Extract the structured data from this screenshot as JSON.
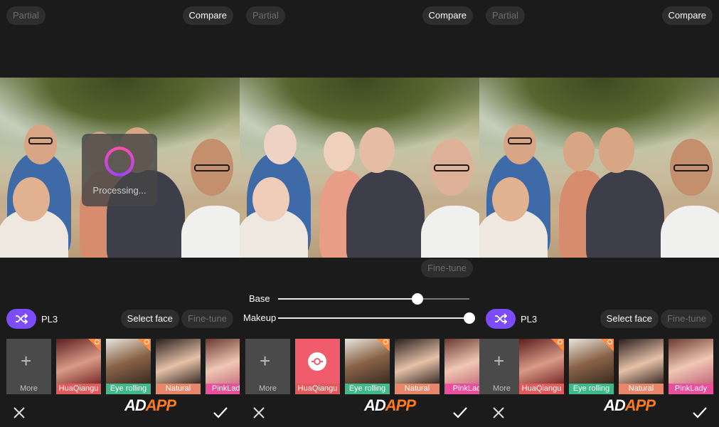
{
  "colors": {
    "accent": "#7c4dff",
    "selected": "#ff5aa5",
    "badge": "#ff8a3d"
  },
  "watermark": {
    "prefix": "AD",
    "suffix": "APP"
  },
  "panels": [
    {
      "top": {
        "partial": "Partial",
        "compare": "Compare"
      },
      "processing": "Processing...",
      "style": {
        "name": "PL3",
        "select_face": "Select face",
        "fine_tune": "Fine-tune"
      },
      "strip": [
        {
          "label": "More",
          "icon": "plus-icon"
        },
        {
          "label": "HuaQiangu",
          "bg": "#e35a5a",
          "badge": true
        },
        {
          "label": "Eye rolling",
          "bg": "#3fb88a",
          "badge": true
        },
        {
          "label": "Natural",
          "bg": "#e8866a"
        },
        {
          "label": "PinkLady",
          "bg": "#ea4f9b",
          "selected": true
        }
      ]
    },
    {
      "top": {
        "partial": "Partial",
        "compare": "Compare"
      },
      "fine_tune": "Fine-tune",
      "sliders": [
        {
          "label": "Base",
          "value": 0.73
        },
        {
          "label": "Makeup",
          "value": 1.0
        }
      ],
      "strip": [
        {
          "label": "More",
          "icon": "plus-icon"
        },
        {
          "label": "HuaQiangu",
          "bg": "#e35a5a",
          "selected": true,
          "icon": "adjust-slider-icon"
        },
        {
          "label": "Eye rolling",
          "bg": "#3fb88a",
          "badge": true
        },
        {
          "label": "Natural",
          "bg": "#e8866a"
        },
        {
          "label": "PinkLad",
          "bg": "#ea4f9b"
        }
      ]
    },
    {
      "top": {
        "partial": "Partial",
        "compare": "Compare"
      },
      "style": {
        "name": "PL3",
        "select_face": "Select face",
        "fine_tune": "Fine-tune"
      },
      "strip": [
        {
          "label": "More",
          "icon": "plus-icon"
        },
        {
          "label": "HuaQiangu",
          "bg": "#e35a5a",
          "badge": true
        },
        {
          "label": "Eye rolling",
          "bg": "#3fb88a",
          "badge": true
        },
        {
          "label": "Natural",
          "bg": "#e8866a"
        },
        {
          "label": "PinkLady",
          "bg": "#ea4f9b",
          "selected": true
        }
      ]
    }
  ]
}
